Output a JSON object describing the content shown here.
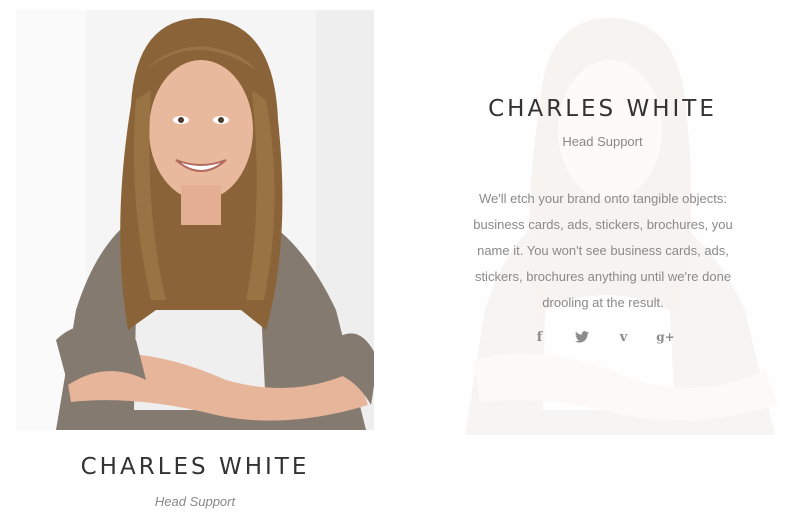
{
  "members": [
    {
      "name": "CHARLES WHITE",
      "role": "Head Support"
    },
    {
      "name": "CHARLES WHITE",
      "role": "Head Support",
      "bio": "We'll etch your brand onto tangible objects: business cards, ads, stickers, brochures, you name it. You won't see business cards, ads, stickers, brochures anything until we're done drooling at the result.",
      "social": [
        "facebook-icon",
        "twitter-icon",
        "vimeo-icon",
        "google-plus-icon"
      ]
    }
  ],
  "colors": {
    "heading": "#333333",
    "muted": "#888888",
    "icon": "#8c8c8c"
  }
}
